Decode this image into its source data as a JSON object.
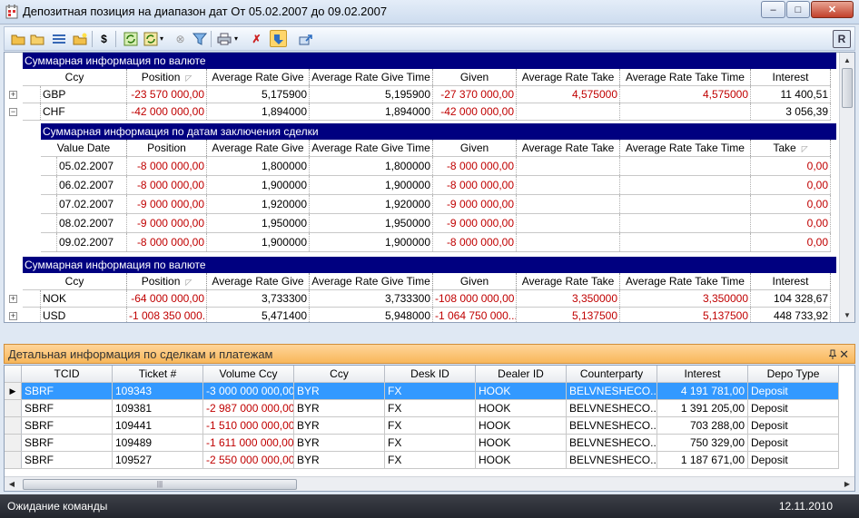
{
  "window": {
    "title": "Депозитная позиция на диапазон дат От 05.02.2007 до 09.02.2007",
    "min": "–",
    "max": "□",
    "close": "✕"
  },
  "toolbar": {
    "items": [
      {
        "name": "open-folder-icon",
        "glyph": "📂"
      },
      {
        "name": "folder-icon",
        "glyph": "📁"
      },
      {
        "name": "list-icon",
        "glyph": "☰"
      },
      {
        "name": "new-folder-icon",
        "glyph": "🗀"
      },
      {
        "name": "dollar-icon",
        "glyph": "$"
      },
      {
        "name": "refresh-icon",
        "glyph": "⟳"
      },
      {
        "name": "refresh-all-icon",
        "glyph": "⟲"
      },
      {
        "name": "dropdown-arrow-icon",
        "glyph": "▾"
      },
      {
        "name": "cancel-icon",
        "glyph": "⊗"
      },
      {
        "name": "filter-icon",
        "glyph": "▼"
      },
      {
        "name": "print-icon",
        "glyph": "⎙"
      },
      {
        "name": "dropdown-arrow-icon",
        "glyph": "▾"
      },
      {
        "name": "clear-filter-icon",
        "glyph": "✗"
      },
      {
        "name": "detail-toggle-icon",
        "glyph": "⇩"
      },
      {
        "name": "export-icon",
        "glyph": "⇪"
      }
    ],
    "right_logo": "R"
  },
  "upper": {
    "band1": {
      "title": "Суммарная информация по валюте",
      "columns": [
        "Ccy",
        "Position",
        "Average Rate Give",
        "Average Rate Give Time",
        "Given",
        "Average Rate Take",
        "Average Rate Take Time",
        "Interest"
      ],
      "rows": [
        {
          "expander": "+",
          "ccy": "GBP",
          "position": "-23 570 000,00",
          "arg": "5,175900",
          "argt": "5,195900",
          "given": "-27 370 000,00",
          "art": "4,575000",
          "artt": "4,575000",
          "interest": "11 400,51"
        },
        {
          "expander": "−",
          "ccy": "CHF",
          "position": "-42 000 000,00",
          "arg": "1,894000",
          "argt": "1,894000",
          "given": "-42 000 000,00",
          "art": "",
          "artt": "",
          "interest": "3 056,39"
        }
      ]
    },
    "detail": {
      "title": "Суммарная информация по датам заключения сделки",
      "columns": [
        "Value Date",
        "Position",
        "Average Rate Give",
        "Average Rate Give Time",
        "Given",
        "Average Rate Take",
        "Average Rate Take Time",
        "Take"
      ],
      "rows": [
        {
          "date": "05.02.2007",
          "position": "-8 000 000,00",
          "arg": "1,800000",
          "argt": "1,800000",
          "given": "-8 000 000,00",
          "take": "0,00"
        },
        {
          "date": "06.02.2007",
          "position": "-8 000 000,00",
          "arg": "1,900000",
          "argt": "1,900000",
          "given": "-8 000 000,00",
          "take": "0,00"
        },
        {
          "date": "07.02.2007",
          "position": "-9 000 000,00",
          "arg": "1,920000",
          "argt": "1,920000",
          "given": "-9 000 000,00",
          "take": "0,00"
        },
        {
          "date": "08.02.2007",
          "position": "-9 000 000,00",
          "arg": "1,950000",
          "argt": "1,950000",
          "given": "-9 000 000,00",
          "take": "0,00"
        },
        {
          "date": "09.02.2007",
          "position": "-8 000 000,00",
          "arg": "1,900000",
          "argt": "1,900000",
          "given": "-8 000 000,00",
          "take": "0,00"
        }
      ]
    },
    "band2": {
      "title": "Суммарная информация по валюте",
      "columns": [
        "Ccy",
        "Position",
        "Average Rate Give",
        "Average Rate Give Time",
        "Given",
        "Average Rate Take",
        "Average Rate Take Time",
        "Interest"
      ],
      "rows": [
        {
          "expander": "+",
          "ccy": "NOK",
          "position": "-64 000 000,00",
          "arg": "3,733300",
          "argt": "3,733300",
          "given": "-108 000 000,00",
          "art": "3,350000",
          "artt": "3,350000",
          "interest": "104 328,67"
        },
        {
          "expander": "+",
          "ccy": "USD",
          "position": "-1 008 350 000...",
          "arg": "5,471400",
          "argt": "5,948000",
          "given": "-1 064 750 000...",
          "art": "5,137500",
          "artt": "5,137500",
          "interest": "448 733,92"
        }
      ]
    }
  },
  "lower": {
    "title": "Детальная информация по сделкам и платежам",
    "pin": "ᵖ",
    "close": "✕",
    "columns": [
      "TCID",
      "Ticket #",
      "Volume Ccy",
      "Ccy",
      "Desk ID",
      "Dealer ID",
      "Counterparty",
      "Interest",
      "Depo Type"
    ],
    "rows": [
      {
        "tcid": "SBRF",
        "ticket": "109343",
        "volume": "-3 000 000 000,00",
        "ccy": "BYR",
        "desk": "FX",
        "dealer": "HOOK",
        "cp": "BELVNESHECO....",
        "interest": "4 191 781,00",
        "depo": "Deposit",
        "selected": true
      },
      {
        "tcid": "SBRF",
        "ticket": "109381",
        "volume": "-2 987 000 000,00",
        "ccy": "BYR",
        "desk": "FX",
        "dealer": "HOOK",
        "cp": "BELVNESHECO....",
        "interest": "1 391 205,00",
        "depo": "Deposit",
        "selected": false
      },
      {
        "tcid": "SBRF",
        "ticket": "109441",
        "volume": "-1 510 000 000,00",
        "ccy": "BYR",
        "desk": "FX",
        "dealer": "HOOK",
        "cp": "BELVNESHECO....",
        "interest": "703 288,00",
        "depo": "Deposit",
        "selected": false
      },
      {
        "tcid": "SBRF",
        "ticket": "109489",
        "volume": "-1 611 000 000,00",
        "ccy": "BYR",
        "desk": "FX",
        "dealer": "HOOK",
        "cp": "BELVNESHECO....",
        "interest": "750 329,00",
        "depo": "Deposit",
        "selected": false
      },
      {
        "tcid": "SBRF",
        "ticket": "109527",
        "volume": "-2 550 000 000,00",
        "ccy": "BYR",
        "desk": "FX",
        "dealer": "HOOK",
        "cp": "BELVNESHECO....",
        "interest": "1 187 671,00",
        "depo": "Deposit",
        "selected": false
      }
    ]
  },
  "status": {
    "message": "Ожидание команды",
    "date": "12.11.2010"
  },
  "colors": {
    "band": "#000080",
    "negative": "#c00000",
    "selection": "#3399ff",
    "panel_header": "#f8b75a"
  }
}
